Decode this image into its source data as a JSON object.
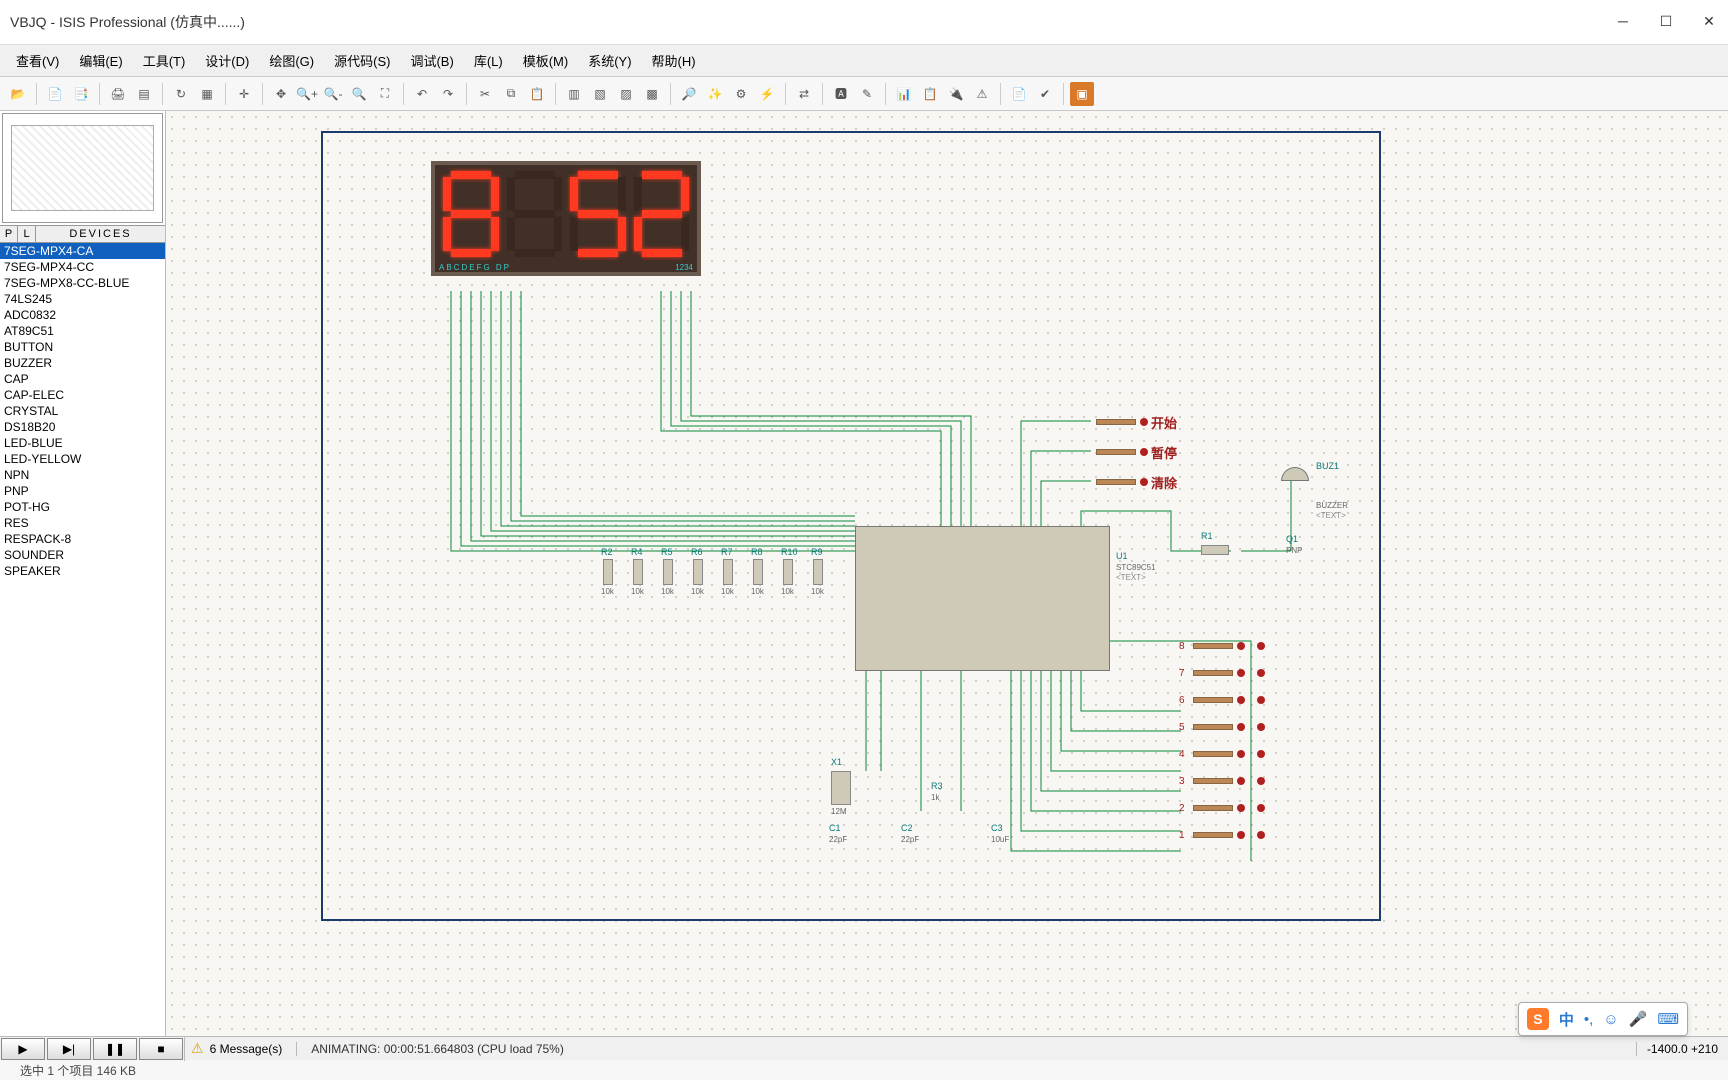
{
  "title": "VBJQ - ISIS Professional (仿真中......)",
  "menu": [
    "查看(V)",
    "编辑(E)",
    "工具(T)",
    "设计(D)",
    "绘图(G)",
    "源代码(S)",
    "调试(B)",
    "库(L)",
    "模板(M)",
    "系统(Y)",
    "帮助(H)"
  ],
  "devices_header": "DEVICES",
  "pl_p": "P",
  "pl_l": "L",
  "devices": [
    "7SEG-MPX4-CA",
    "7SEG-MPX4-CC",
    "7SEG-MPX8-CC-BLUE",
    "74LS245",
    "ADC0832",
    "AT89C51",
    "BUTTON",
    "BUZZER",
    "CAP",
    "CAP-ELEC",
    "CRYSTAL",
    "DS18B20",
    "LED-BLUE",
    "LED-YELLOW",
    "NPN",
    "PNP",
    "POT-HG",
    "RES",
    "RESPACK-8",
    "SOUNDER",
    "SPEAKER"
  ],
  "selected_device_index": 0,
  "display": {
    "pin_label_left": "ABCDEFG  DP",
    "pin_label_right": "1234",
    "digits": [
      {
        "a": 1,
        "b": 1,
        "c": 1,
        "d": 1,
        "e": 1,
        "f": 1,
        "g": 1
      },
      {
        "a": 0,
        "b": 0,
        "c": 0,
        "d": 0,
        "e": 0,
        "f": 0,
        "g": 0
      },
      {
        "a": 1,
        "b": 0,
        "c": 1,
        "d": 1,
        "e": 0,
        "f": 1,
        "g": 1
      },
      {
        "a": 1,
        "b": 1,
        "c": 0,
        "d": 1,
        "e": 1,
        "f": 0,
        "g": 1
      }
    ]
  },
  "annotations": {
    "btn1": "开始",
    "btn2": "暂停",
    "btn3": "清除",
    "buz_ref": "BUZ1",
    "buz_type": "BUZZER",
    "buz_text": "<TEXT>",
    "q1_ref": "Q1",
    "q1_type": "PNP",
    "u1_ref": "U1",
    "u1_type": "STC89C51",
    "r1_ref": "R1",
    "x1_ref": "X1",
    "x1_val": "12M",
    "c1_ref": "C1",
    "c1_val": "22pF",
    "c2_ref": "C2",
    "c2_val": "22pF",
    "c3_ref": "C3",
    "c3_val": "10uF",
    "r3_ref": "R3",
    "r3_val": "1k",
    "resistors": [
      "R2",
      "R4",
      "R5",
      "R6",
      "R7",
      "R8",
      "R10",
      "R9"
    ],
    "res_val": "10k",
    "side_sw_nums": [
      "8",
      "7",
      "6",
      "5",
      "4",
      "3",
      "2",
      "1"
    ]
  },
  "status": {
    "messages_label": "6 Message(s)",
    "anim_label": "ANIMATING: 00:00:51.664803 (CPU load 75%)",
    "coords": "-1400.0   +210"
  },
  "bottom2": "选中 1 个项目   146 KB",
  "ime": {
    "cn": "中",
    "punct": "•,",
    "emoji": "☺",
    "mic": "🎤",
    "kbd": "⌨"
  }
}
